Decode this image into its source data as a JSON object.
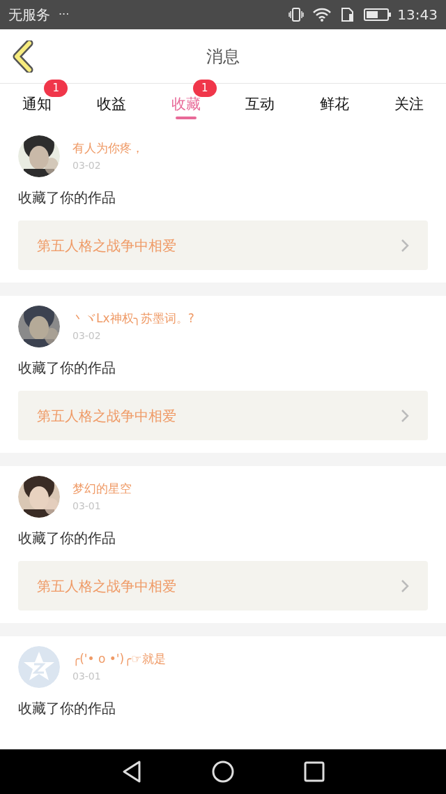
{
  "status_bar": {
    "carrier": "无服务",
    "more": "···",
    "time": "13:43"
  },
  "header": {
    "title": "消息"
  },
  "tabs": [
    {
      "label": "通知",
      "selected": false,
      "badge": "1"
    },
    {
      "label": "收益",
      "selected": false
    },
    {
      "label": "收藏",
      "selected": true,
      "badge": "1"
    },
    {
      "label": "互动",
      "selected": false
    },
    {
      "label": "鲜花",
      "selected": false
    },
    {
      "label": "关注",
      "selected": false
    }
  ],
  "messages": [
    {
      "name": "有人为你疼，",
      "date": "03-02",
      "action": "收藏了你的作品",
      "work_title": "第五人格之战争中相爱"
    },
    {
      "name": "丶ヾLx神权╮苏墨词。?",
      "date": "03-02",
      "action": "收藏了你的作品",
      "work_title": "第五人格之战争中相爱"
    },
    {
      "name": "梦幻的星空",
      "date": "03-01",
      "action": "收藏了你的作品",
      "work_title": "第五人格之战争中相爱"
    },
    {
      "avatar": {
        "kind": "default"
      },
      "name": "╭('• o •')╭☞就是",
      "date": "03-01",
      "action": "收藏了你的作品"
    }
  ]
}
